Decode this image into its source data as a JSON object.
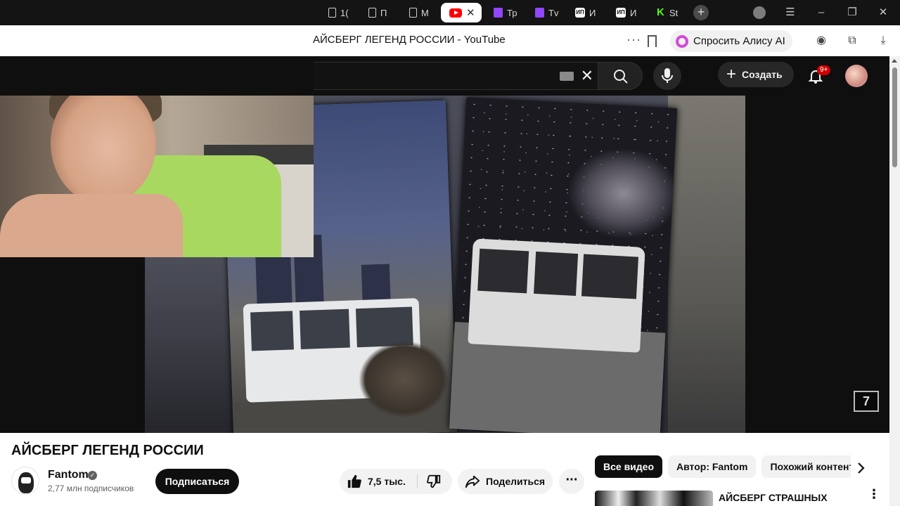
{
  "browser": {
    "tabs": [
      {
        "icon": "doc-icon",
        "label": "1("
      },
      {
        "icon": "doc-icon",
        "label": "П"
      },
      {
        "icon": "doc-icon",
        "label": "М"
      },
      {
        "icon": "youtube-icon",
        "label": "",
        "active": true
      },
      {
        "icon": "twitch-icon",
        "label": "Тр"
      },
      {
        "icon": "twitch-icon",
        "label": "Тv"
      },
      {
        "icon": "mytischi-icon",
        "label": "И"
      },
      {
        "icon": "mytischi-icon",
        "label": "И"
      },
      {
        "icon": "kick-icon",
        "label": "St"
      }
    ],
    "page_title": "АЙСБЕРГ ЛЕГЕНД РОССИИ - YouTube",
    "alice_button": "Спросить Алису AI"
  },
  "youtube": {
    "create_label": "Создать",
    "notifications_badge": "9+"
  },
  "video": {
    "title": "АЙСБЕРГ ЛЕГЕНД РОССИИ",
    "watermark": "7"
  },
  "channel": {
    "name": "Fantom",
    "subscribers": "2,77 млн подписчиков",
    "subscribe_label": "Подписаться"
  },
  "actions": {
    "likes": "7,5 тыс.",
    "share_label": "Поделиться"
  },
  "chips": [
    "Все видео",
    "Автор: Fantom",
    "Похожий контент"
  ],
  "recommendation": {
    "title": "АЙСБЕРГ СТРАШНЫХ"
  },
  "colors": {
    "youtube_red": "#ff0000",
    "masthead_bg": "#0f0f0f",
    "twitch_purple": "#9146ff",
    "kick_green": "#53fc18",
    "alice_accent": "#d14bd6"
  }
}
